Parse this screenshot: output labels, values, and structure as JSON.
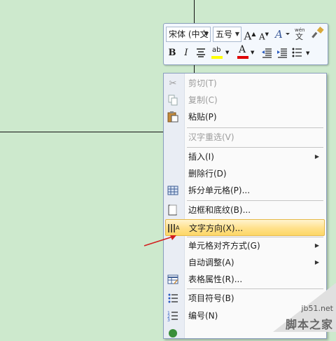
{
  "mini_toolbar": {
    "font_name": "宋体 (中文",
    "font_size": "五号",
    "grow_font": "A",
    "shrink_font": "A",
    "bold": "B",
    "italic": "I",
    "highlight": "ab",
    "font_color": "A"
  },
  "menu": {
    "items": [
      {
        "label": "剪切(T)",
        "icon": "scissors-icon",
        "disabled": true
      },
      {
        "label": "复制(C)",
        "icon": "copy-icon",
        "disabled": true
      },
      {
        "label": "粘贴(P)",
        "icon": "paste-icon",
        "disabled": false
      },
      {
        "label": "汉字重选(V)",
        "icon": "",
        "disabled": true
      },
      {
        "label": "插入(I)",
        "icon": "",
        "disabled": false,
        "submenu": true
      },
      {
        "label": "删除行(D)",
        "icon": "",
        "disabled": false
      },
      {
        "label": "拆分单元格(P)...",
        "icon": "split-cells-icon",
        "disabled": false
      },
      {
        "label": "边框和底纹(B)...",
        "icon": "borders-icon",
        "disabled": false
      },
      {
        "label": "文字方向(X)...",
        "icon": "text-direction-icon",
        "disabled": false,
        "highlight": true
      },
      {
        "label": "单元格对齐方式(G)",
        "icon": "",
        "disabled": false,
        "submenu": true
      },
      {
        "label": "自动调整(A)",
        "icon": "",
        "disabled": false,
        "submenu": true
      },
      {
        "label": "表格属性(R)...",
        "icon": "table-properties-icon",
        "disabled": false
      },
      {
        "label": "项目符号(B)",
        "icon": "bullets-icon",
        "disabled": false,
        "submenu": true
      },
      {
        "label": "编号(N)",
        "icon": "numbering-icon",
        "disabled": false,
        "submenu": true
      }
    ]
  },
  "watermark": {
    "site": "jb51.net",
    "name": "脚本之家"
  },
  "colors": {
    "background": "#cde9cd",
    "highlight": "#ffe08a",
    "arrow": "#d21e1e",
    "font_color_bar": "#e00000",
    "highlight_bar": "#ffff00"
  }
}
